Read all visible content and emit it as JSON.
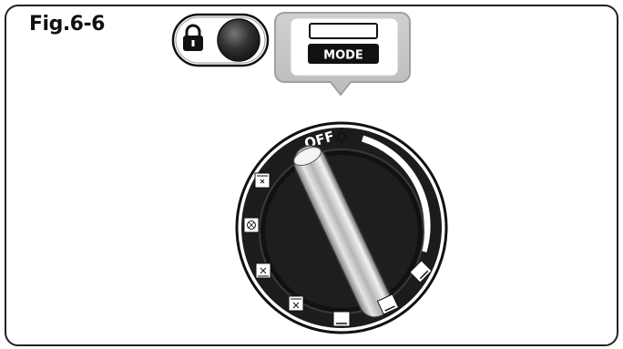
{
  "figure": {
    "label": "Fig.6-6"
  },
  "controls": {
    "lock_icon": "padlock-icon",
    "button": "round-button",
    "mode_label": "MODE"
  },
  "dial": {
    "off_label": "OFF",
    "symbols": [
      "sun-heat-icon",
      "fan-grill-icon",
      "fan-icon",
      "bottom-fan-icon",
      "grill-icon",
      "bottom-heat-icon",
      "top-bottom-heat-icon",
      "top-heat-icon"
    ]
  },
  "colors": {
    "dial_dark": "#1c1c1c",
    "handle_light": "#d9d9d9",
    "frame_stroke": "#222222"
  }
}
